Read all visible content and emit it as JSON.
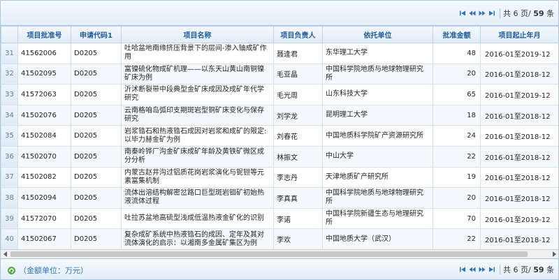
{
  "pager": {
    "total_prefix": "共",
    "total_pages": "6",
    "pages_suffix": "页/",
    "total_items": "59",
    "items_suffix": "条"
  },
  "columns": [
    "",
    "项目批准号",
    "申请代码1",
    "项目名称",
    "项目负责人",
    "依托单位",
    "批准金额",
    "项目起止年月"
  ],
  "rows": [
    {
      "n": "31",
      "id": "41562006",
      "code": "D0205",
      "name": "吐哈盆地南缘挤压背景下的层间-渗入铀成矿作用",
      "leader": "聂逢君",
      "unit": "东华理工大学",
      "amount": "48",
      "period": "2016-01至2019-12"
    },
    {
      "n": "32",
      "id": "41502095",
      "code": "D0205",
      "name": "富镍硫化物成矿机理——以东天山黄山南铜镍矿床为例",
      "leader": "毛亚晶",
      "unit": "中国科学院地质与地球物理研究所",
      "amount": "20",
      "period": "2016-01至2018-12"
    },
    {
      "n": "33",
      "id": "41572063",
      "code": "D0205",
      "name": "沂沭断裂带中段典型金矿床成因及成矿年代学研究",
      "leader": "毛光周",
      "unit": "山东科技大学",
      "amount": "65",
      "period": "2016-01至2019-12"
    },
    {
      "n": "34",
      "id": "41502076",
      "code": "D0205",
      "name": "云南格咱岛弧印支期斑岩型铜矿床变化与保存研究",
      "leader": "刘学龙",
      "unit": "昆明理工大学",
      "amount": "18",
      "period": "2016-01至2018-12"
    },
    {
      "n": "35",
      "id": "41502084",
      "code": "D0205",
      "name": "岩浆锆石和热液锆石成因对岩浆和成矿的限定:以毕力赫金矿为例",
      "leader": "刘春花",
      "unit": "中国地质科学院矿产资源研究所",
      "amount": "24",
      "period": "2016-01至2018-12"
    },
    {
      "n": "36",
      "id": "41502070",
      "code": "D0205",
      "name": "南秦岭铧厂沟金矿床成矿年龄及黄铁矿微区成分分析",
      "leader": "林振文",
      "unit": "中山大学",
      "amount": "22",
      "period": "2016-01至2018-12"
    },
    {
      "n": "37",
      "id": "41502082",
      "code": "D0205",
      "name": "内蒙古赵井沟过铝质花岗岩浆演化与铌钽等元素富集机制",
      "leader": "李志丹",
      "unit": "天津地质矿产研究所",
      "amount": "19",
      "period": "2016-01至2018-12"
    },
    {
      "n": "38",
      "id": "41502094",
      "code": "D0205",
      "name": "流体出溶结构解密岔路口巨型斑岩钼矿初始热液流体过程",
      "leader": "李真真",
      "unit": "中国科学院地质与地球物理研究所",
      "amount": "20",
      "period": "2016-01至2018-12"
    },
    {
      "n": "39",
      "id": "41572070",
      "code": "D0205",
      "name": "吐拉苏盆地高硫型浅成低温热液金矿化的识别",
      "leader": "李诺",
      "unit": "中国科学院新疆生态与地理研究所",
      "amount": "70",
      "period": "2016-01至2019-12"
    },
    {
      "n": "40",
      "id": "41502067",
      "code": "D0205",
      "name": "复杂成矿系统中热液锆石的成因、定年及其对流体演化的启示：以湘南多金属矿集区为例",
      "leader": "李欢",
      "unit": "中国地质大学（武汉）",
      "amount": "22",
      "period": "2016-01至2018-12"
    }
  ],
  "footer": {
    "note": "（金额单位：万元）"
  },
  "icons": {
    "first": "first-page-icon",
    "prev": "prev-page-icon",
    "next": "next-page-icon",
    "last": "last-page-icon",
    "refresh": "refresh-icon"
  }
}
